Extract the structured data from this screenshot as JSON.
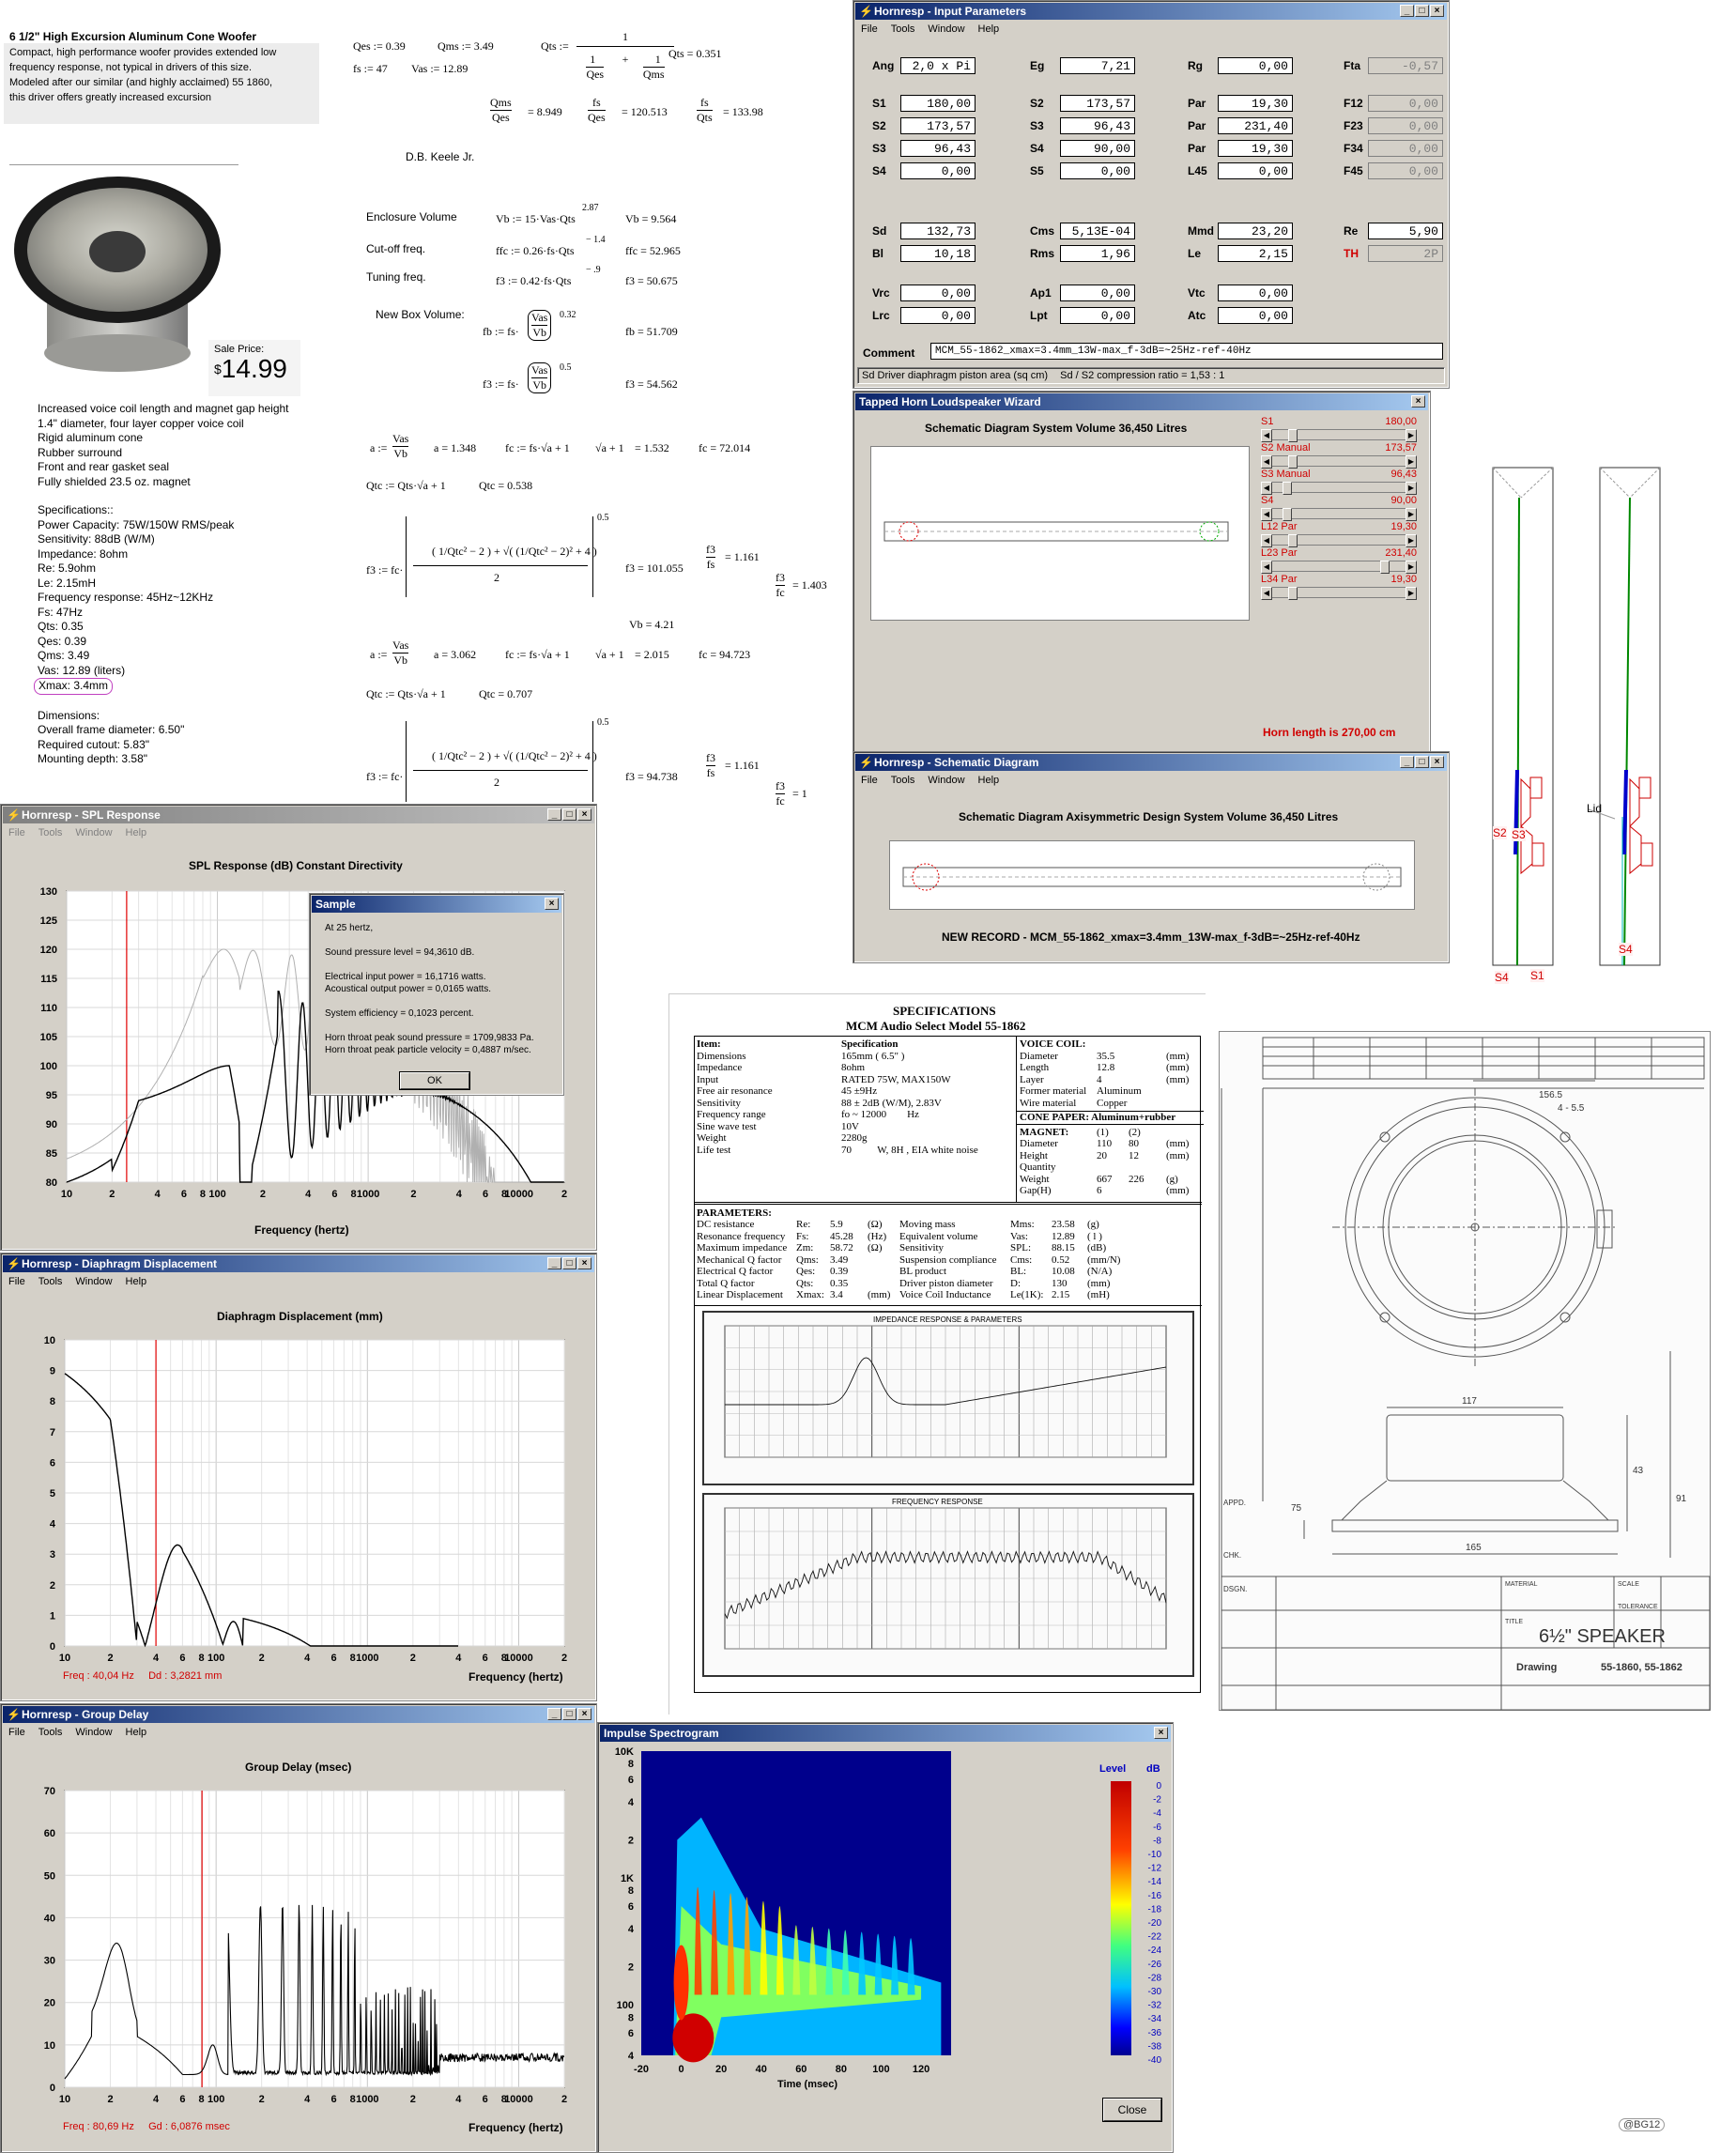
{
  "product": {
    "title": "6 1/2\" High Excursion Aluminum Cone Woofer",
    "desc": [
      "Compact, high performance woofer provides extended low",
      "frequency response, not typical in drivers of this size.",
      "Modeled after our similar (and highly acclaimed) 55 1860,",
      "this driver offers greatly increased excursion"
    ],
    "sale_label": "Sale Price:",
    "price_dollar": "$",
    "price": "14.99",
    "features": [
      "Increased voice coil length and magnet gap height",
      "1.4\" diameter, four layer copper voice coil",
      "Rigid aluminum cone",
      "Rubber surround",
      "Front and rear gasket seal",
      "Fully shielded 23.5 oz. magnet"
    ],
    "specs_title": "Specifications::",
    "specs": [
      "Power Capacity: 75W/150W RMS/peak",
      "Sensitivity: 88dB (W/M)",
      "Impedance: 8ohm",
      "Re: 5.9ohm",
      "Le: 2.15mH",
      "Frequency response: 45Hz~12KHz",
      "Fs: 47Hz",
      "Qts: 0.35",
      "Qes: 0.39",
      "Qms: 3.49",
      "Vas: 12.89 (liters)"
    ],
    "xmax": "Xmax: 3.4mm",
    "dims_title": "Dimensions:",
    "dims": [
      "Overall frame diameter: 6.50\"",
      "Required cutout: 5.83\"",
      "Mounting depth: 3.58\""
    ]
  },
  "math": {
    "qes": "Qes := 0.39",
    "qms": "Qms := 3.49",
    "fs": "fs := 47",
    "vas": "Vas := 12.89",
    "qts_lbl": "Qts :=",
    "qts_val": "Qts = 0.351",
    "r1": "= 8.949",
    "r2": "= 120.513",
    "r3": "= 133.98",
    "author": "D.B. Keele Jr.",
    "enc_lbl": "Enclosure Volume",
    "enc_eq": "Vb := 15·Vas·Qts",
    "enc_exp": "2.87",
    "enc_val": "Vb = 9.564",
    "cut_lbl": "Cut-off freq.",
    "cut_eq": "ffc := 0.26·fs·Qts",
    "cut_exp": "− 1.4",
    "cut_val": "ffc = 52.965",
    "tun_lbl": "Tuning freq.",
    "tun_eq": "f3 := 0.42·fs·Qts",
    "tun_exp": "− .9",
    "tun_val": "f3 = 50.675",
    "nbv_lbl": "New Box Volume:",
    "fb_val": "fb = 51.709",
    "f3b_val": "f3 = 54.562",
    "a1_val": "a = 1.348",
    "fc1_val": "fc = 72.014",
    "sq1_val": "= 1.532",
    "qtc1_val": "Qtc = 0.538",
    "f31_val": "f3 = 101.055",
    "r31": "= 1.161",
    "r32": "= 1.403",
    "vb2": "Vb = 4.21",
    "a2_val": "a = 3.062",
    "fc2_val": "fc = 94.723",
    "sq2_val": "= 2.015",
    "qtc2_val": "Qtc = 0.707",
    "f32_val": "f3 = 94.738",
    "r33": "= 1.161",
    "r34": "= 1"
  },
  "input_params": {
    "title": "Hornresp - Input Parameters",
    "menu": [
      "File",
      "Tools",
      "Window",
      "Help"
    ],
    "rows": [
      [
        [
          "Ang",
          "2,0 x Pi",
          "w"
        ],
        [
          "Eg",
          "7,21",
          "w"
        ],
        [
          "Rg",
          "0,00",
          "w"
        ],
        [
          "Fta",
          "-0,57",
          "d"
        ]
      ],
      [
        [
          "S1",
          "180,00",
          "w"
        ],
        [
          "S2",
          "173,57",
          "w"
        ],
        [
          "Par",
          "19,30",
          "w"
        ],
        [
          "F12",
          "0,00",
          "d"
        ]
      ],
      [
        [
          "S2",
          "173,57",
          "w"
        ],
        [
          "S3",
          "96,43",
          "w"
        ],
        [
          "Par",
          "231,40",
          "w"
        ],
        [
          "F23",
          "0,00",
          "d"
        ]
      ],
      [
        [
          "S3",
          "96,43",
          "w"
        ],
        [
          "S4",
          "90,00",
          "w"
        ],
        [
          "Par",
          "19,30",
          "w"
        ],
        [
          "F34",
          "0,00",
          "d"
        ]
      ],
      [
        [
          "S4",
          "0,00",
          "w"
        ],
        [
          "S5",
          "0,00",
          "w"
        ],
        [
          "L45",
          "0,00",
          "w"
        ],
        [
          "F45",
          "0,00",
          "d"
        ]
      ],
      [
        [
          "Sd",
          "132,73",
          "w"
        ],
        [
          "Cms",
          "5,13E-04",
          "w"
        ],
        [
          "Mmd",
          "23,20",
          "w"
        ],
        [
          "Re",
          "5,90",
          "w"
        ]
      ],
      [
        [
          "Bl",
          "10,18",
          "w"
        ],
        [
          "Rms",
          "1,96",
          "w"
        ],
        [
          "Le",
          "2,15",
          "w"
        ],
        [
          "TH",
          "2P",
          "d"
        ]
      ],
      [
        [
          "Vrc",
          "0,00",
          "w"
        ],
        [
          "Ap1",
          "0,00",
          "w"
        ],
        [
          "Vtc",
          "0,00",
          "w"
        ]
      ],
      [
        [
          "Lrc",
          "0,00",
          "w"
        ],
        [
          "Lpt",
          "0,00",
          "w"
        ],
        [
          "Atc",
          "0,00",
          "w"
        ]
      ]
    ],
    "comment_lbl": "Comment",
    "comment": "MCM_55-1862_xmax=3.4mm_13W-max_f-3dB=~25Hz-ref-40Hz",
    "status1": "Sd  Driver diaphragm piston area (sq cm)",
    "status2": "Sd / S2 compression ratio = 1,53 : 1"
  },
  "wizard": {
    "title": "Tapped Horn Loudspeaker Wizard",
    "header": "Schematic Diagram    System Volume 36,450 Litres",
    "sliders": [
      {
        "label": "S1",
        "value": "180,00",
        "frac": 0.12
      },
      {
        "label": "S2 Manual",
        "value": "173,57",
        "frac": 0.12
      },
      {
        "label": "S3 Manual",
        "value": "96,43",
        "frac": 0.08
      },
      {
        "label": "S4",
        "value": "90,00",
        "frac": 0.08
      },
      {
        "label": "L12 Par",
        "value": "19,30",
        "frac": 0.12
      },
      {
        "label": "L23 Par",
        "value": "231,40",
        "frac": 0.88
      },
      {
        "label": "L34 Par",
        "value": "19,30",
        "frac": 0.12
      }
    ],
    "horn_length": "Horn length is 270,00 cm"
  },
  "schematic": {
    "title": "Hornresp - Schematic Diagram",
    "menu": [
      "File",
      "Tools",
      "Window",
      "Help"
    ],
    "header": "Schematic Diagram    Axisymmetric Design    System Volume 36,450 Litres",
    "record": "NEW RECORD - MCM_55-1862_xmax=3.4mm_13W-max_f-3dB=~25Hz-ref-40Hz"
  },
  "side_labels": {
    "s2": "S2",
    "s3": "S3",
    "s4a": "S4",
    "s1": "S1",
    "lid": "Lid",
    "s4b": "S4"
  },
  "spl": {
    "title": "Hornresp - SPL Response",
    "menu": [
      "File",
      "Tools",
      "Window",
      "Help"
    ],
    "chart_title": "SPL Response (dB)    Constant Directivity",
    "xlabel": "Frequency (hertz)",
    "yticks": [
      "130",
      "125",
      "120",
      "115",
      "110",
      "105",
      "100",
      "95",
      "90",
      "85",
      "80"
    ],
    "xticks": [
      "10",
      "2",
      "4",
      "6",
      "8",
      "100",
      "2",
      "4",
      "6",
      "8",
      "1000",
      "2",
      "4",
      "6",
      "8",
      "10000",
      "2"
    ],
    "dialog": {
      "title": "Sample",
      "lines": [
        "At 25 hertz,",
        "",
        "Sound pressure level = 94,3610 dB.",
        "",
        "Electrical input power = 16,1716 watts.",
        "Acoustical output power = 0,0165 watts.",
        "",
        "System efficiency = 0,1023 percent.",
        "",
        "Horn throat peak sound pressure = 1709,9833 Pa.",
        "Horn throat peak particle velocity = 0,4887 m/sec."
      ],
      "ok": "OK"
    }
  },
  "disp": {
    "title": "Hornresp - Diaphragm Displacement",
    "menu": [
      "File",
      "Tools",
      "Window",
      "Help"
    ],
    "chart_title": "Diaphragm Displacement (mm)",
    "xlabel": "Frequency (hertz)",
    "yticks": [
      "10",
      "9",
      "8",
      "7",
      "6",
      "5",
      "4",
      "3",
      "2",
      "1",
      "0"
    ],
    "xticks": [
      "10",
      "2",
      "4",
      "6",
      "8",
      "100",
      "2",
      "4",
      "6",
      "8",
      "1000",
      "2",
      "4",
      "6",
      "8",
      "10000",
      "2"
    ],
    "readout": "Freq : 40,04 Hz     Dd : 3,2821 mm"
  },
  "gd": {
    "title": "Hornresp - Group Delay",
    "menu": [
      "File",
      "Tools",
      "Window",
      "Help"
    ],
    "chart_title": "Group Delay (msec)",
    "xlabel": "Frequency (hertz)",
    "yticks": [
      "70",
      "60",
      "50",
      "40",
      "30",
      "20",
      "10",
      "0"
    ],
    "xticks": [
      "10",
      "2",
      "4",
      "6",
      "8",
      "100",
      "2",
      "4",
      "6",
      "8",
      "1000",
      "2",
      "4",
      "6",
      "8",
      "10000",
      "2"
    ],
    "readout": "Freq : 80,69 Hz     Gd : 6,0876 msec"
  },
  "spectro": {
    "title": "Impulse Spectrogram",
    "yticks": [
      "10K",
      "8",
      "6",
      "4",
      "2",
      "1K",
      "8",
      "6",
      "4",
      "2",
      "100",
      "8",
      "6",
      "4"
    ],
    "xticks": [
      "-20",
      "0",
      "20",
      "40",
      "60",
      "80",
      "100",
      "120"
    ],
    "xlabel": "Time (msec)",
    "level_lbl": "Level",
    "db_lbl": "dB",
    "levels": [
      "0",
      "-2",
      "-4",
      "-6",
      "-8",
      "-10",
      "-12",
      "-14",
      "-16",
      "-18",
      "-20",
      "-22",
      "-24",
      "-26",
      "-28",
      "-30",
      "-32",
      "-34",
      "-36",
      "-38",
      "-40"
    ],
    "close": "Close"
  },
  "spec_sheet": {
    "h1": "SPECIFICATIONS",
    "h2": "MCM Audio Select Model 55-1862",
    "items_hdr": [
      "Item:",
      "Specification"
    ],
    "items": [
      [
        "Dimensions",
        "165mm ( 6.5\" )"
      ],
      [
        "Impedance",
        "8ohm"
      ],
      [
        "Input",
        "RATED 75W, MAX150W"
      ],
      [
        "Free air resonance",
        "45 ±9Hz"
      ],
      [
        "Sensitivity",
        "88 ± 2dB (W/M), 2.83V"
      ],
      [
        "Frequency range",
        "fo ~ 12000        Hz"
      ],
      [
        "Sine wave test",
        "10V"
      ],
      [
        "Weight",
        "2280g"
      ],
      [
        "Life test",
        "70          W, 8H , EIA white noise"
      ]
    ],
    "vc_hdr": "VOICE COIL:",
    "vc": [
      [
        "Diameter",
        "35.5",
        "(mm)"
      ],
      [
        "Length",
        "12.8",
        "(mm)"
      ],
      [
        "Layer",
        "4",
        "(mm)"
      ],
      [
        "Former material",
        "Aluminum",
        ""
      ],
      [
        "Wire material",
        "Copper",
        ""
      ]
    ],
    "cone": "CONE PAPER: Aluminum+rubber",
    "mag_hdr": "MAGNET:",
    "mag_cols": [
      "(1)",
      "(2)"
    ],
    "mag": [
      [
        "Diameter",
        "110",
        "80",
        "(mm)"
      ],
      [
        "Height",
        "20",
        "12",
        "(mm)"
      ],
      [
        "Quantity",
        "",
        "",
        ""
      ],
      [
        "Weight",
        "667",
        "226",
        "(g)"
      ],
      [
        "Gap(H)",
        "6",
        "",
        "(mm)"
      ]
    ],
    "par_hdr": "PARAMETERS:",
    "params": [
      [
        "DC resistance",
        "Re:",
        "5.9",
        "(Ω)",
        "Moving mass",
        "Mms:",
        "23.58",
        "(g)"
      ],
      [
        "Resonance frequency",
        "Fs:",
        "45.28",
        "(Hz)",
        "Equivalent volume",
        "Vas:",
        "12.89",
        "( l )"
      ],
      [
        "Maximum impedance",
        "Zm:",
        "58.72",
        "(Ω)",
        "Sensitivity",
        "SPL:",
        "88.15",
        "(dB)"
      ],
      [
        "Mechanical Q factor",
        "Qms:",
        "3.49",
        "",
        "Suspension compliance",
        "Cms:",
        "0.52",
        "(mm/N)"
      ],
      [
        "Electrical Q factor",
        "Qes:",
        "0.39",
        "",
        "BL product",
        "BL:",
        "10.08",
        "(N/A)"
      ],
      [
        "Total Q factor",
        "Qts:",
        "0.35",
        "",
        "Driver piston diameter",
        "D:",
        "130",
        "(mm)"
      ],
      [
        "Linear Displacement",
        "Xmax:",
        "3.4",
        "(mm)",
        "Voice Coil Inductance",
        "Le(1K):",
        "2.15",
        "(mH)"
      ]
    ],
    "g1_title": "IMPEDANCE RESPONSE & PARAMETERS",
    "g2_title": "FREQUENCY RESPONSE"
  },
  "drawing": {
    "dim1": "156.5",
    "dim2": "4 - 5.5",
    "dim3": "117",
    "dim4": "165",
    "dim5": "75",
    "dim6": "43",
    "dim7": "91",
    "title": "6½\" SPEAKER",
    "drawing_lbl": "Drawing",
    "drawing_no": "55-1860, 55-1862",
    "scale": "SCALE",
    "tolerance": "TOLERANCE",
    "material": "MATERIAL",
    "title_lbl": "TITLE",
    "dsgn": "DSGN.",
    "appd": "APPD.",
    "chk": "CHK."
  },
  "watermark": "@BG12"
}
